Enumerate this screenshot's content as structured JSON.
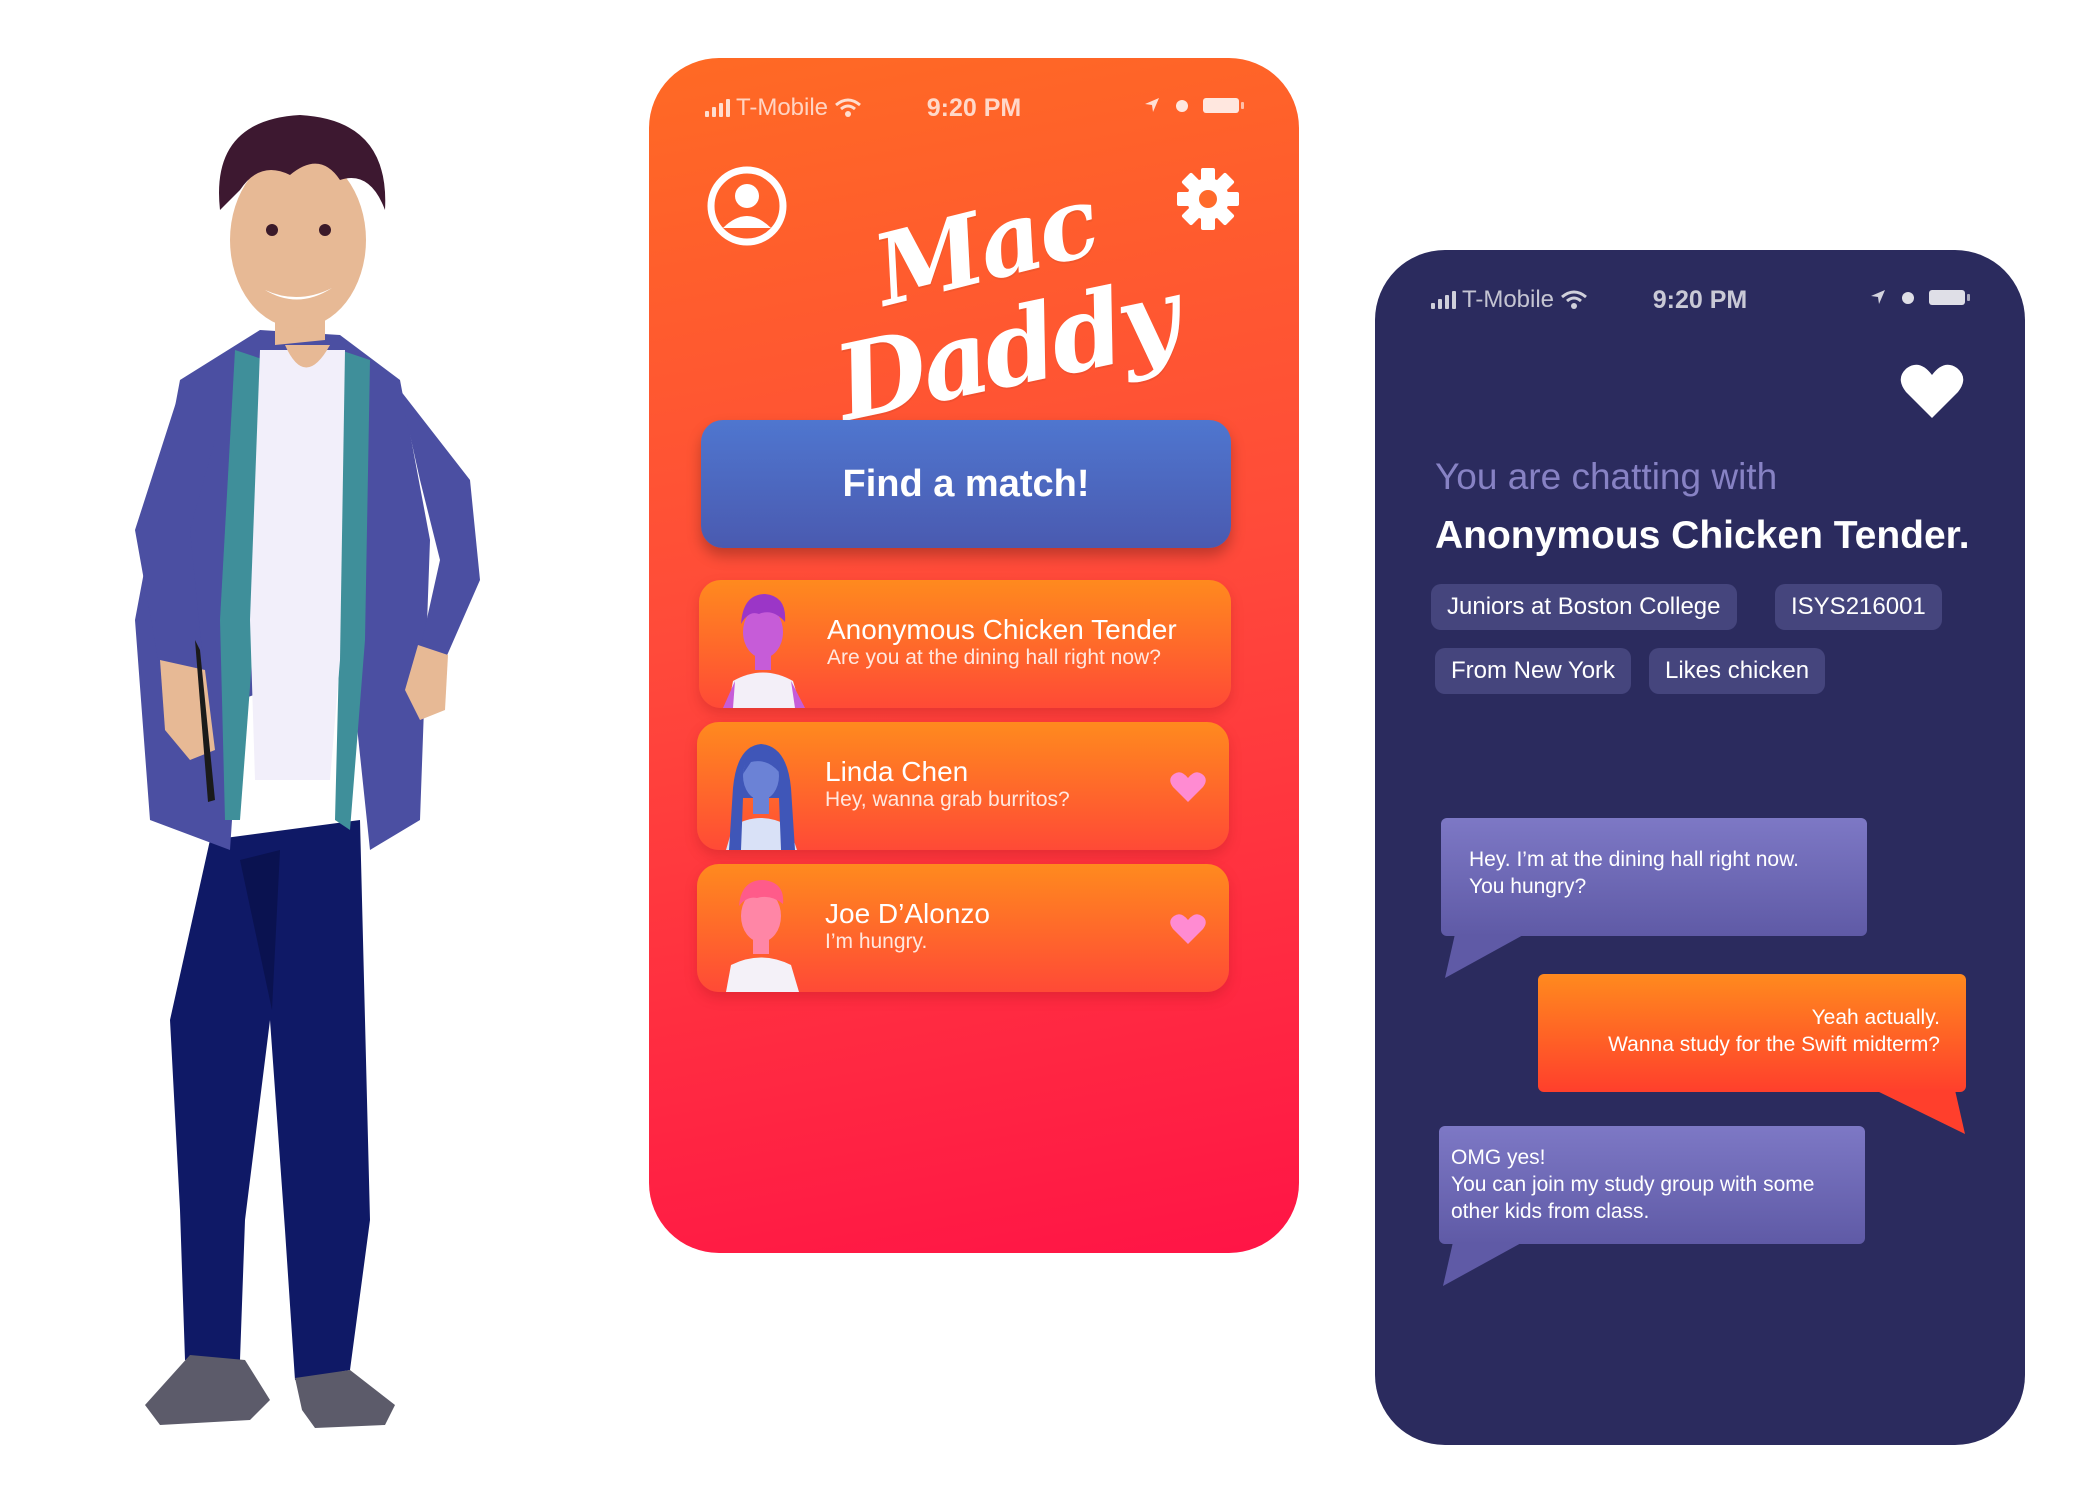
{
  "status_bar": {
    "carrier": "T-Mobile",
    "time": "9:20 PM"
  },
  "home_screen": {
    "logo_line1": "Mac",
    "logo_line2": "Daddy",
    "find_match_label": "Find a match!",
    "matches": [
      {
        "name": "Anonymous Chicken Tender",
        "message": "Are you at the dining hall right now?",
        "liked": false,
        "hair_color": "#9b36c7"
      },
      {
        "name": "Linda Chen",
        "message": "Hey, wanna grab burritos?",
        "liked": true,
        "hair_color": "#3f56b8"
      },
      {
        "name": "Joe D’Alonzo",
        "message": "I’m hungry.",
        "liked": true,
        "hair_color": "#ff5b8a"
      }
    ]
  },
  "chat_screen": {
    "intro": "You are chatting with",
    "partner_name": "Anonymous Chicken Tender.",
    "tags": [
      "Juniors at Boston College",
      "ISYS216001",
      "From New York",
      "Likes chicken"
    ],
    "messages": [
      {
        "from": "them",
        "lines": [
          "Hey. I’m at the dining hall right now.",
          "You hungry?"
        ]
      },
      {
        "from": "me",
        "lines": [
          "Yeah actually.",
          "Wanna study for the Swift midterm?"
        ]
      },
      {
        "from": "them",
        "lines": [
          "OMG yes!",
          "You can join my study group with some",
          "other kids from class."
        ]
      }
    ]
  },
  "colors": {
    "orange_gradient_top": "#ff6a24",
    "orange_gradient_bottom": "#ff1446",
    "navy": "#2b2b5e",
    "button_blue": "#4f76cf",
    "tag_bg": "#45457d",
    "bubble_purple": "#7d78c5",
    "heart_pink": "#ff8bd2"
  }
}
